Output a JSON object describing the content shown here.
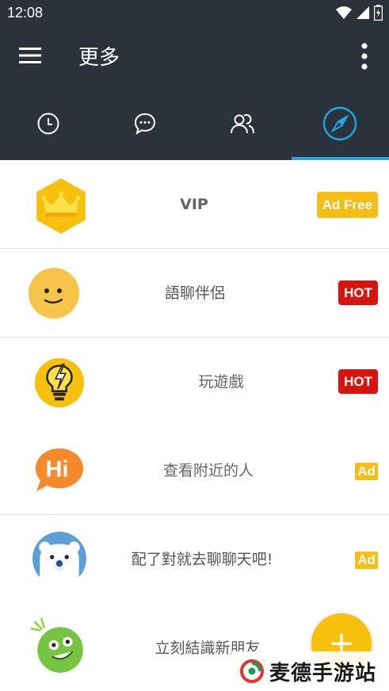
{
  "status_bar": {
    "time": "12:08"
  },
  "app_bar": {
    "title": "更多"
  },
  "tabs": [
    {
      "name": "recent-icon"
    },
    {
      "name": "chat-icon"
    },
    {
      "name": "friends-icon"
    },
    {
      "name": "compass-icon",
      "selected": true
    }
  ],
  "items": [
    {
      "label": "VIP",
      "badge": "Ad Free",
      "icon": "crown-icon"
    },
    {
      "label": "語聊伴侶",
      "badge": "HOT",
      "icon": "smiley-icon"
    },
    {
      "label": "玩遊戲",
      "badge": "HOT",
      "icon": "lightbulb-icon"
    },
    {
      "label": "查看附近的人",
      "badge": "Ad",
      "icon": "hi-bubble-icon"
    },
    {
      "label": "配了對就去聊聊天吧!",
      "badge": "Ad",
      "icon": "polar-bear-icon"
    },
    {
      "label": "立刻結識新朋友",
      "icon": "green-face-icon"
    }
  ],
  "fab": {
    "label": "+"
  },
  "watermark": {
    "text": "麦德手游站"
  },
  "colors": {
    "header": "#2b323c",
    "accent": "#1da8e3",
    "hot": "#d7140e",
    "yellow": "#f5bd16"
  }
}
